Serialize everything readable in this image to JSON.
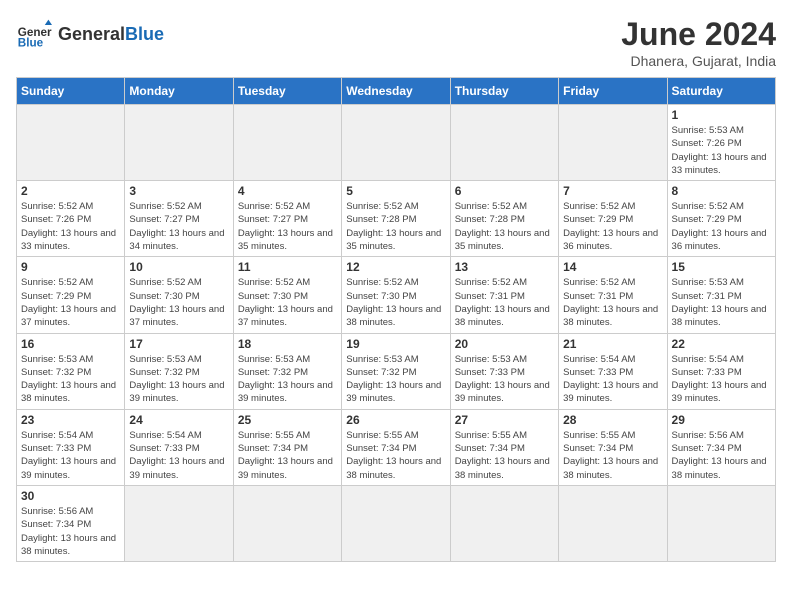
{
  "header": {
    "logo_general": "General",
    "logo_blue": "Blue",
    "month_title": "June 2024",
    "location": "Dhanera, Gujarat, India"
  },
  "weekdays": [
    "Sunday",
    "Monday",
    "Tuesday",
    "Wednesday",
    "Thursday",
    "Friday",
    "Saturday"
  ],
  "weeks": [
    [
      {
        "day": "",
        "empty": true
      },
      {
        "day": "",
        "empty": true
      },
      {
        "day": "",
        "empty": true
      },
      {
        "day": "",
        "empty": true
      },
      {
        "day": "",
        "empty": true
      },
      {
        "day": "",
        "empty": true
      },
      {
        "day": "1",
        "sunrise": "5:53 AM",
        "sunset": "7:26 PM",
        "daylight": "13 hours and 33 minutes."
      }
    ],
    [
      {
        "day": "2",
        "sunrise": "5:52 AM",
        "sunset": "7:26 PM",
        "daylight": "13 hours and 33 minutes."
      },
      {
        "day": "3",
        "sunrise": "5:52 AM",
        "sunset": "7:27 PM",
        "daylight": "13 hours and 34 minutes."
      },
      {
        "day": "4",
        "sunrise": "5:52 AM",
        "sunset": "7:27 PM",
        "daylight": "13 hours and 35 minutes."
      },
      {
        "day": "5",
        "sunrise": "5:52 AM",
        "sunset": "7:28 PM",
        "daylight": "13 hours and 35 minutes."
      },
      {
        "day": "6",
        "sunrise": "5:52 AM",
        "sunset": "7:28 PM",
        "daylight": "13 hours and 35 minutes."
      },
      {
        "day": "7",
        "sunrise": "5:52 AM",
        "sunset": "7:29 PM",
        "daylight": "13 hours and 36 minutes."
      },
      {
        "day": "8",
        "sunrise": "5:52 AM",
        "sunset": "7:29 PM",
        "daylight": "13 hours and 36 minutes."
      }
    ],
    [
      {
        "day": "9",
        "sunrise": "5:52 AM",
        "sunset": "7:29 PM",
        "daylight": "13 hours and 37 minutes."
      },
      {
        "day": "10",
        "sunrise": "5:52 AM",
        "sunset": "7:30 PM",
        "daylight": "13 hours and 37 minutes."
      },
      {
        "day": "11",
        "sunrise": "5:52 AM",
        "sunset": "7:30 PM",
        "daylight": "13 hours and 37 minutes."
      },
      {
        "day": "12",
        "sunrise": "5:52 AM",
        "sunset": "7:30 PM",
        "daylight": "13 hours and 38 minutes."
      },
      {
        "day": "13",
        "sunrise": "5:52 AM",
        "sunset": "7:31 PM",
        "daylight": "13 hours and 38 minutes."
      },
      {
        "day": "14",
        "sunrise": "5:52 AM",
        "sunset": "7:31 PM",
        "daylight": "13 hours and 38 minutes."
      },
      {
        "day": "15",
        "sunrise": "5:53 AM",
        "sunset": "7:31 PM",
        "daylight": "13 hours and 38 minutes."
      }
    ],
    [
      {
        "day": "16",
        "sunrise": "5:53 AM",
        "sunset": "7:32 PM",
        "daylight": "13 hours and 38 minutes."
      },
      {
        "day": "17",
        "sunrise": "5:53 AM",
        "sunset": "7:32 PM",
        "daylight": "13 hours and 39 minutes."
      },
      {
        "day": "18",
        "sunrise": "5:53 AM",
        "sunset": "7:32 PM",
        "daylight": "13 hours and 39 minutes."
      },
      {
        "day": "19",
        "sunrise": "5:53 AM",
        "sunset": "7:32 PM",
        "daylight": "13 hours and 39 minutes."
      },
      {
        "day": "20",
        "sunrise": "5:53 AM",
        "sunset": "7:33 PM",
        "daylight": "13 hours and 39 minutes."
      },
      {
        "day": "21",
        "sunrise": "5:54 AM",
        "sunset": "7:33 PM",
        "daylight": "13 hours and 39 minutes."
      },
      {
        "day": "22",
        "sunrise": "5:54 AM",
        "sunset": "7:33 PM",
        "daylight": "13 hours and 39 minutes."
      }
    ],
    [
      {
        "day": "23",
        "sunrise": "5:54 AM",
        "sunset": "7:33 PM",
        "daylight": "13 hours and 39 minutes."
      },
      {
        "day": "24",
        "sunrise": "5:54 AM",
        "sunset": "7:33 PM",
        "daylight": "13 hours and 39 minutes."
      },
      {
        "day": "25",
        "sunrise": "5:55 AM",
        "sunset": "7:34 PM",
        "daylight": "13 hours and 39 minutes."
      },
      {
        "day": "26",
        "sunrise": "5:55 AM",
        "sunset": "7:34 PM",
        "daylight": "13 hours and 38 minutes."
      },
      {
        "day": "27",
        "sunrise": "5:55 AM",
        "sunset": "7:34 PM",
        "daylight": "13 hours and 38 minutes."
      },
      {
        "day": "28",
        "sunrise": "5:55 AM",
        "sunset": "7:34 PM",
        "daylight": "13 hours and 38 minutes."
      },
      {
        "day": "29",
        "sunrise": "5:56 AM",
        "sunset": "7:34 PM",
        "daylight": "13 hours and 38 minutes."
      }
    ],
    [
      {
        "day": "30",
        "sunrise": "5:56 AM",
        "sunset": "7:34 PM",
        "daylight": "13 hours and 38 minutes."
      },
      {
        "day": "",
        "empty": true
      },
      {
        "day": "",
        "empty": true
      },
      {
        "day": "",
        "empty": true
      },
      {
        "day": "",
        "empty": true
      },
      {
        "day": "",
        "empty": true
      },
      {
        "day": "",
        "empty": true
      }
    ]
  ]
}
